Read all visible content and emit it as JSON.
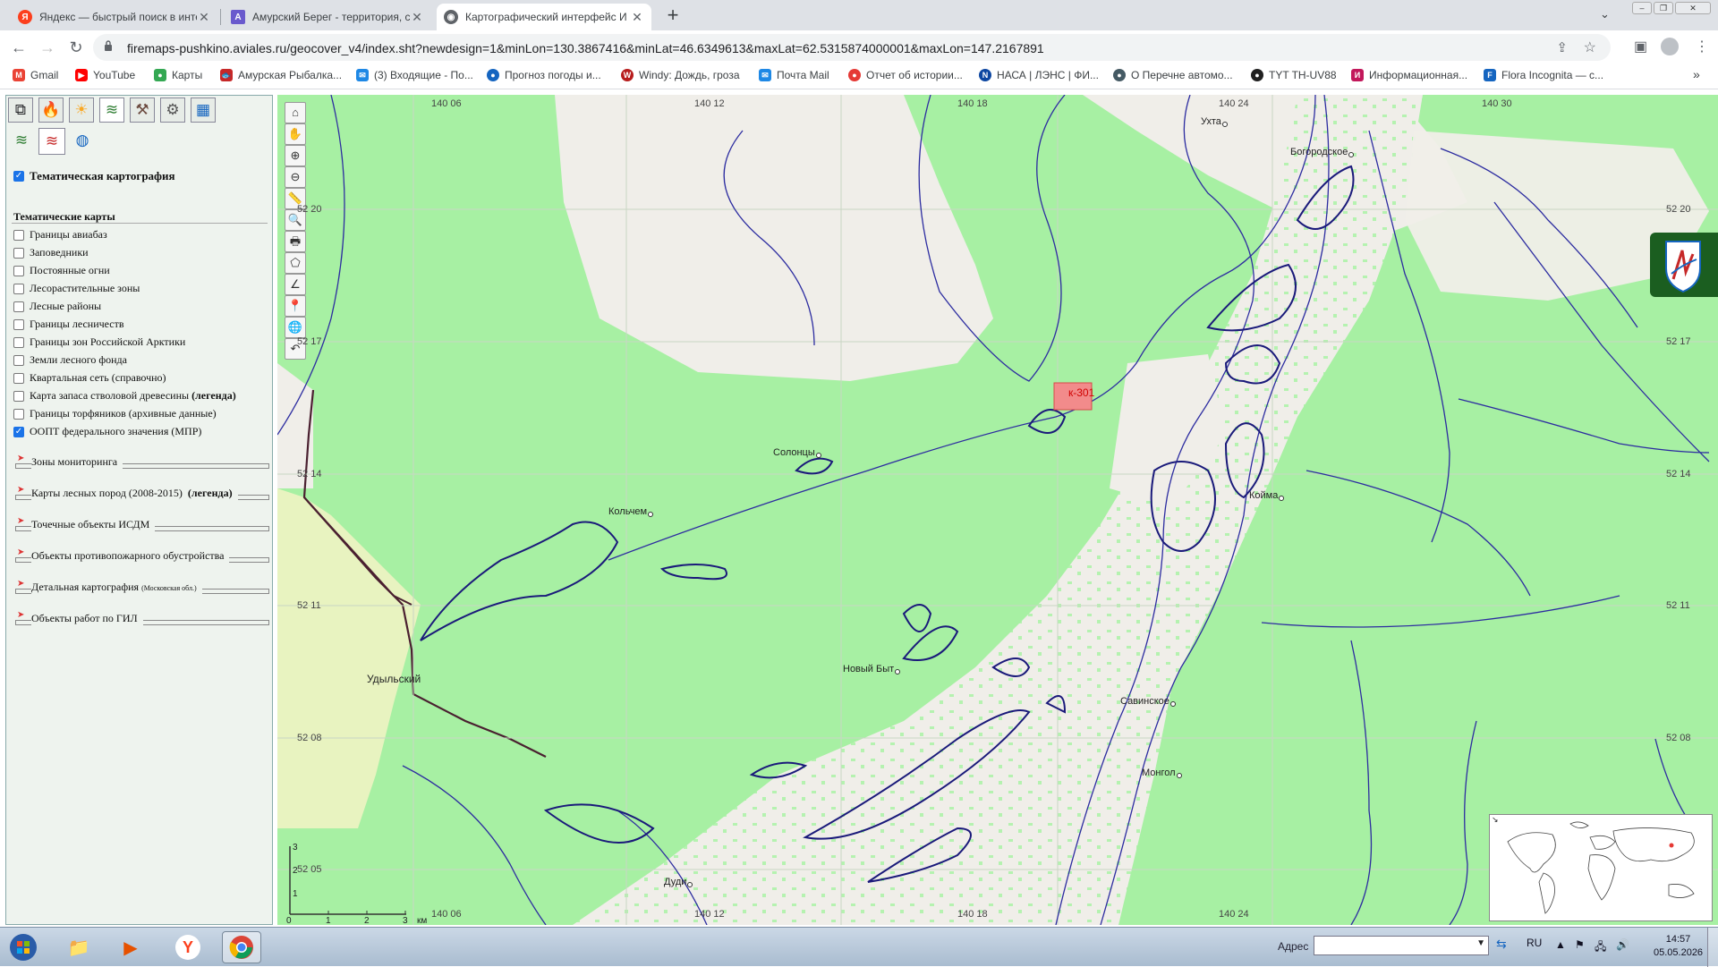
{
  "browser": {
    "tabs": [
      {
        "title": "Яндекс — быстрый поиск в инте",
        "icon": "yandex-icon",
        "color": "#fc3f1d",
        "glyph": "Я"
      },
      {
        "title": "Амурский Берег - территория, с",
        "icon": "amur-bereg-icon",
        "color": "#6a5acd",
        "glyph": "А"
      },
      {
        "title": "Картографический интерфейс И",
        "icon": "globe-icon",
        "color": "#5f6368",
        "glyph": "◉"
      }
    ],
    "url": "firemaps-pushkino.aviales.ru/geocover_v4/index.sht?newdesign=1&minLon=130.3867416&minLat=46.6349613&maxLat=62.5315874000001&maxLon=147.2167891",
    "bookmarks": [
      {
        "label": "Gmail",
        "color": "#ea4335",
        "glyph": "M"
      },
      {
        "label": "YouTube",
        "color": "#ff0000",
        "glyph": "▶"
      },
      {
        "label": "Карты",
        "color": "#34a853",
        "glyph": "●"
      },
      {
        "label": "Амурская Рыбалка...",
        "color": "#c62828",
        "glyph": "🐟"
      },
      {
        "label": "(3) Входящие - По...",
        "color": "#1e88e5",
        "glyph": "✉"
      },
      {
        "label": "Прогноз погоды и...",
        "color": "#1565c0",
        "glyph": "●"
      },
      {
        "label": "Windy: Дождь, гроза",
        "color": "#b71c1c",
        "glyph": "W"
      },
      {
        "label": "Почта Mail",
        "color": "#1e88e5",
        "glyph": "✉"
      },
      {
        "label": "Отчет об истории...",
        "color": "#e53935",
        "glyph": "●"
      },
      {
        "label": "НАСА | ЛЭНС | ФИ...",
        "color": "#0d47a1",
        "glyph": "N"
      },
      {
        "label": "О Перечне автомо...",
        "color": "#455a64",
        "glyph": "●"
      },
      {
        "label": "TYT TH-UV88",
        "color": "#212121",
        "glyph": "●"
      },
      {
        "label": "Информационная...",
        "color": "#c2185b",
        "glyph": "И"
      },
      {
        "label": "Flora Incognita — с...",
        "color": "#1565c0",
        "glyph": "F"
      }
    ],
    "more_bookmarks": "»"
  },
  "panel": {
    "tab_icons": [
      "layers-icon",
      "fire-icon",
      "sun-icon",
      "stack-icon",
      "tools-icon",
      "gear-icon",
      "table-icon"
    ],
    "subtab_icons": [
      "layers-icon",
      "red-layers-icon",
      "globe-layers-icon"
    ],
    "main_toggle": "Тематическая картография",
    "section_title": "Тематические карты",
    "layers": [
      {
        "label": "Границы авиабаз",
        "checked": false
      },
      {
        "label": "Заповедники",
        "checked": false
      },
      {
        "label": "Постоянные огни",
        "checked": false
      },
      {
        "label": "Лесорастительные зоны",
        "checked": false
      },
      {
        "label": "Лесные районы",
        "checked": false
      },
      {
        "label": "Границы лесничеств",
        "checked": false
      },
      {
        "label": "Границы зон Российской Арктики",
        "checked": false
      },
      {
        "label": "Земли лесного фонда",
        "checked": false
      },
      {
        "label": "Квартальная сеть (справочно)",
        "checked": false
      },
      {
        "label": "Карта запаса стволовой древесины",
        "legend": "(легенда)",
        "checked": false
      },
      {
        "label": "Границы торфяников (архивные данные)",
        "checked": false
      },
      {
        "label": "ООПТ федерального значения (МПР)",
        "checked": true
      }
    ],
    "sections": [
      {
        "label": "Зоны мониторинга"
      },
      {
        "label": "Карты лесных пород (2008-2015)",
        "bold": "(легенда)"
      },
      {
        "label": "Точечные объекты ИСДМ"
      },
      {
        "label": "Объекты противопожарного обустройства"
      },
      {
        "label": "Детальная картография",
        "small": "(Московская обл.)"
      },
      {
        "label": "Объекты работ по ГИЛ"
      }
    ]
  },
  "map": {
    "top_lon_labels": [
      "140 06",
      "140 12",
      "140 18",
      "140 24",
      "140 30"
    ],
    "bottom_lon_labels": [
      "140 06",
      "140 12",
      "140 18",
      "140 24"
    ],
    "left_lat_labels": [
      "52 20",
      "52 17",
      "52 14",
      "52 11",
      "52 08",
      "52 05"
    ],
    "right_lat_labels": [
      "52 20",
      "52 17",
      "52 14",
      "52 11",
      "52 08"
    ],
    "places": [
      {
        "name": "Ухта"
      },
      {
        "name": "Богородское"
      },
      {
        "name": "Солонцы"
      },
      {
        "name": "Кольчем"
      },
      {
        "name": "Койма"
      },
      {
        "name": "Новый Быт"
      },
      {
        "name": "Савинское"
      },
      {
        "name": "Монгол"
      },
      {
        "name": "Дуди"
      }
    ],
    "district": "Удыльский",
    "fire_label": "к-301",
    "fire_color": "#f28b8b",
    "scale": {
      "ticks": [
        "0",
        "1",
        "2",
        "3"
      ],
      "unit": "км",
      "vticks": [
        "3",
        "2",
        "1"
      ]
    },
    "tool_icons": [
      "overview-icon",
      "pan-hand-icon",
      "zoom-in-icon",
      "zoom-out-icon",
      "ruler-icon",
      "identify-icon",
      "print-icon",
      "select-polygon-icon",
      "measure-angle-icon",
      "marker-icon",
      "globe-icon",
      "undo-icon"
    ]
  },
  "taskbar": {
    "address_label": "Адрес",
    "lang": "RU",
    "time": "14:57",
    "date": "05.05.2026"
  }
}
